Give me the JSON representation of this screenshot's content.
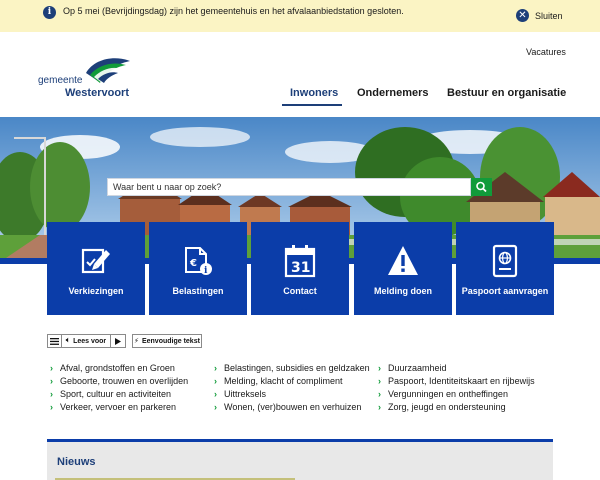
{
  "alert": {
    "info_icon": "info-icon",
    "message": "Op 5 mei (Bevrijdingsdag) zijn het gemeentehuis en het afvalaanbiedstation gesloten.",
    "close_label": "Sluiten",
    "close_icon": "close-icon",
    "background": "#fbf4c4"
  },
  "header": {
    "top_link": "Vacatures",
    "logo_line1": "gemeente",
    "logo_line2": "Westervoort",
    "nav": [
      "Inwoners",
      "Ondernemers",
      "Bestuur en organisatie"
    ],
    "active_nav": "Inwoners"
  },
  "search": {
    "placeholder": "Waar bent u naar op zoek?",
    "button_icon": "search-icon"
  },
  "tiles": [
    {
      "label": "Verkiezingen",
      "icon": "ballot-pen-icon"
    },
    {
      "label": "Belastingen",
      "icon": "tax-document-icon"
    },
    {
      "label": "Contact",
      "icon": "calendar-31-icon"
    },
    {
      "label": "Melding doen",
      "icon": "warning-icon"
    },
    {
      "label": "Paspoort aanvragen",
      "icon": "passport-icon"
    }
  ],
  "read_aloud": {
    "label": "Lees voor",
    "easy_text": "Eenvoudige tekst"
  },
  "links": {
    "col1": [
      "Afval, grondstoffen en Groen",
      "Geboorte, trouwen en overlijden",
      "Sport, cultuur en activiteiten",
      "Verkeer, vervoer en parkeren"
    ],
    "col2": [
      "Belastingen, subsidies en geldzaken",
      "Melding, klacht of compliment",
      "Uittreksels",
      "Wonen, (ver)bouwen en verhuizen"
    ],
    "col3": [
      "Duurzaamheid",
      "Paspoort, Identiteitskaart en rijbewijs",
      "Vergunningen en ontheffingen",
      "Zorg, jeugd en ondersteuning"
    ]
  },
  "news": {
    "title": "Nieuws"
  },
  "colors": {
    "brand_blue": "#0b3da9",
    "dark_blue": "#1d3f79",
    "green": "#119b3a"
  }
}
